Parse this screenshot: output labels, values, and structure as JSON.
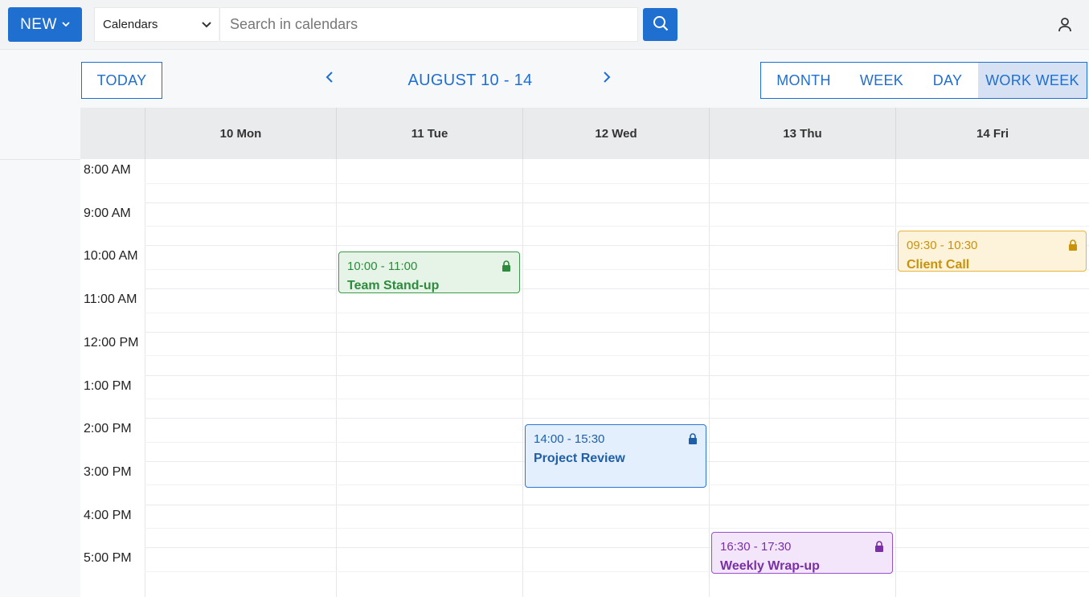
{
  "toolbar": {
    "new_label": "NEW",
    "calendar_select": "Calendars",
    "search_placeholder": "Search in calendars"
  },
  "nav": {
    "today_label": "TODAY",
    "range_label": "AUGUST 10 - 14",
    "views": [
      "MONTH",
      "WEEK",
      "DAY",
      "WORK WEEK"
    ],
    "active_view": "WORK WEEK"
  },
  "days": [
    {
      "label": "10 Mon"
    },
    {
      "label": "11 Tue"
    },
    {
      "label": "12 Wed"
    },
    {
      "label": "13 Thu"
    },
    {
      "label": "14 Fri"
    }
  ],
  "time_labels": [
    "8:00 AM",
    "9:00 AM",
    "10:00 AM",
    "11:00 AM",
    "12:00 PM",
    "1:00 PM",
    "2:00 PM",
    "3:00 PM",
    "4:00 PM",
    "5:00 PM"
  ],
  "events": [
    {
      "day": "11 Tue",
      "time": "10:00 - 11:00",
      "title": "Team Stand-up",
      "locked": true,
      "color": "#2e8b3e",
      "bg": "#e6f4e8",
      "border": "#3a9a4a"
    },
    {
      "day": "14 Fri",
      "time": "09:30 - 10:30",
      "title": "Client Call",
      "locked": true,
      "color": "#c9920a",
      "bg": "#fdf3da",
      "border": "#e8b43a"
    },
    {
      "day": "12 Wed",
      "time": "14:00 - 15:30",
      "title": "Project Review",
      "locked": true,
      "color": "#1f5fa8",
      "bg": "#e3effc",
      "border": "#2b78d4"
    },
    {
      "day": "13 Thu",
      "time": "16:30 - 17:30",
      "title": "Weekly Wrap-up",
      "locked": true,
      "color": "#7b2fa6",
      "bg": "#f3e6fb",
      "border": "#9a4ed0"
    }
  ],
  "colors": {
    "accent": "#1f6fd1"
  }
}
